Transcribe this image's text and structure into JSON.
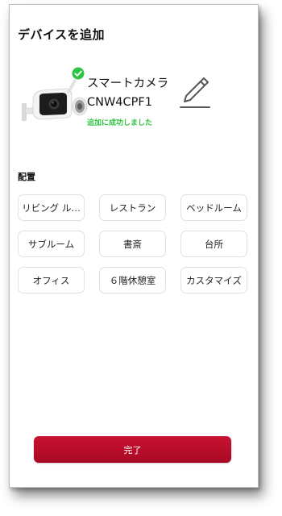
{
  "header": {
    "title": "デバイスを追加"
  },
  "device": {
    "name": "スマートカメラ",
    "model": "CNW4CPF1",
    "status": "追加に成功しました",
    "status_color": "#2ec443"
  },
  "placement": {
    "label": "配置",
    "rooms": [
      {
        "label": "リビング ル…"
      },
      {
        "label": "レストラン"
      },
      {
        "label": "ベッドルーム"
      },
      {
        "label": "サブルーム"
      },
      {
        "label": "書斎"
      },
      {
        "label": "台所"
      },
      {
        "label": "オフィス"
      },
      {
        "label": "６階休憩室"
      },
      {
        "label": "カスタマイズ"
      }
    ]
  },
  "footer": {
    "done_label": "完了",
    "accent": "#b80d2b"
  },
  "icons": [
    "camera-image",
    "check-circle-icon",
    "pencil-edit-icon"
  ]
}
